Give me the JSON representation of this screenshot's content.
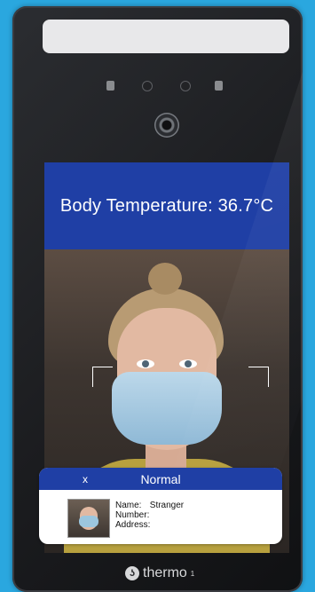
{
  "display": {
    "temperature_label": "Body Temperature: 36.7°C"
  },
  "result_card": {
    "close_label": "x",
    "status": "Normal",
    "fields": [
      {
        "label": "Name:",
        "value": "Stranger"
      },
      {
        "label": "Number:",
        "value": ""
      },
      {
        "label": "Address:",
        "value": ""
      }
    ]
  },
  "brand": {
    "icon": "thermo-logo-icon",
    "name": "thermo",
    "sup": "1"
  },
  "colors": {
    "background": "#2aa7df",
    "header_blue": "#1f3fa5",
    "device_body": "#1b1c1f"
  }
}
